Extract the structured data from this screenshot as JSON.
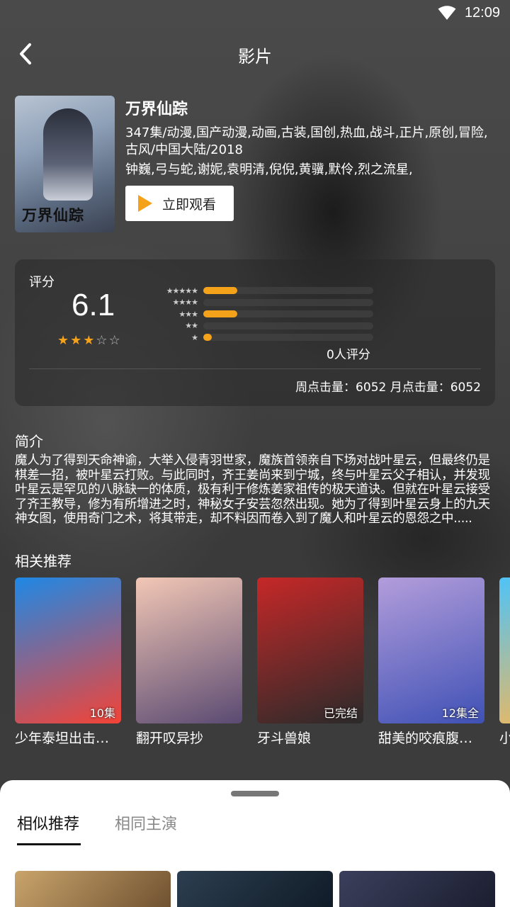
{
  "status": {
    "time": "12:09"
  },
  "header": {
    "title": "影片"
  },
  "movie": {
    "name": "万界仙踪",
    "poster_text": "万界仙踪",
    "meta": "347集/动漫,国产动漫,动画,古装,国创,热血,战斗,正片,原创,冒险,古风/中国大陆/2018",
    "cast": "钟巍,弓与蛇,谢妮,袁明清,倪倪,黄骥,默伶,烈之流星,",
    "watch_label": "立即观看"
  },
  "rating": {
    "label": "评分",
    "score": "6.1",
    "stars_filled": 3,
    "stars_total": 5,
    "distribution": [
      {
        "stars": "★★★★★",
        "fraction": 0.2
      },
      {
        "stars": "★★★★",
        "fraction": 0.0
      },
      {
        "stars": "★★★",
        "fraction": 0.2
      },
      {
        "stars": "★★",
        "fraction": 0.0
      },
      {
        "stars": "★",
        "fraction": 0.05
      }
    ],
    "count_text": "0人评分",
    "clicks_text": "周点击量：6052  月点击量：6052"
  },
  "intro": {
    "title": "简介",
    "text": "魔人为了得到天命神谕，大举入侵青羽世家，魔族首领亲自下场对战叶星云，但最终仍是棋差一招，被叶星云打败。与此同时，齐王姜尚来到宁城，终与叶星云父子相认，并发现叶星云是罕见的八脉缺一的体质，极有利于修炼姜家祖传的极天道诀。但就在叶星云接受了齐王教导，修为有所增进之时，神秘女子安芸忽然出现。她为了得到叶星云身上的九天神女图，使用奇门之术，将其带走，却不料因而卷入到了魔人和叶星云的恩怨之中....."
  },
  "related": {
    "title": "相关推荐",
    "items": [
      {
        "name": "少年泰坦出击…",
        "badge": "10集",
        "colors": [
          "#1e88e5",
          "#f44336"
        ]
      },
      {
        "name": "翻开叹异抄",
        "badge": "",
        "colors": [
          "#f2c7b5",
          "#5a4a72"
        ]
      },
      {
        "name": "牙斗兽娘",
        "badge": "已完结",
        "colors": [
          "#c62828",
          "#2a2a2a"
        ]
      },
      {
        "name": "甜美的咬痕腹…",
        "badge": "12集全",
        "colors": [
          "#b39ddb",
          "#3f51b5"
        ]
      },
      {
        "name": "小",
        "badge": "",
        "colors": [
          "#4fc3f7",
          "#ffb74d"
        ]
      }
    ]
  },
  "sheet": {
    "tabs": [
      "相似推荐",
      "相同主演"
    ],
    "active_tab": 0
  }
}
